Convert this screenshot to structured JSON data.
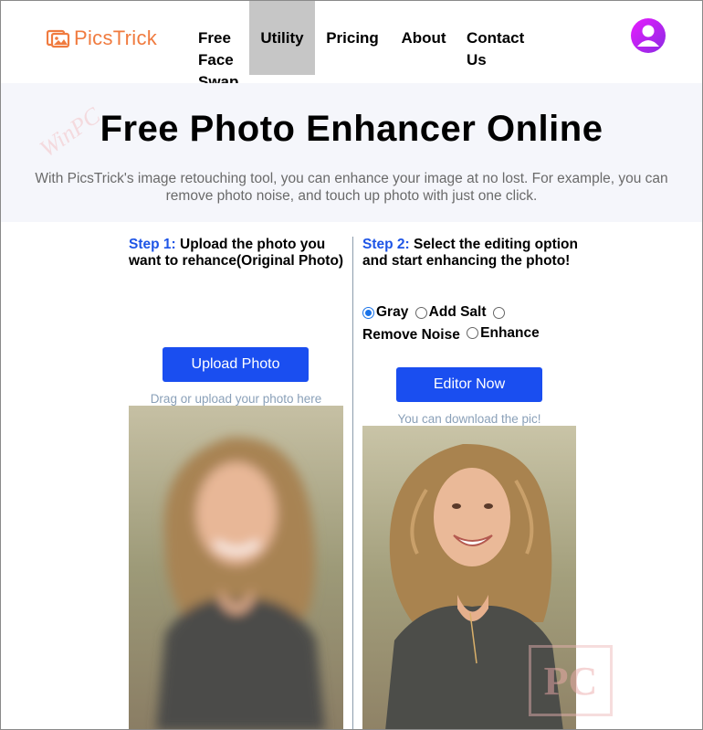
{
  "header": {
    "logo_text": "PicsTrick",
    "nav": [
      {
        "label": "Free Face Swap"
      },
      {
        "label": "Utility",
        "active": true
      },
      {
        "label": "Pricing"
      },
      {
        "label": "About"
      },
      {
        "label": "Contact Us"
      }
    ],
    "avatar_icon": "user-avatar-icon",
    "brand_color": "#f07b3f",
    "avatar_color": "#cc22ee"
  },
  "hero": {
    "title": "Free Photo Enhancer Online",
    "subtitle": "With PicsTrick's image retouching tool, you can enhance your image at no lost. For example, you can remove photo noise, and touch up photo with just one click."
  },
  "step1": {
    "num": "Step 1:",
    "text": " Upload the photo you want to rehance(Original Photo)",
    "button": "Upload Photo",
    "hint": "Drag or upload your photo here"
  },
  "step2": {
    "num": "Step 2:",
    "text": " Select the editing option and start enhancing the photo!",
    "options": [
      {
        "label": "Gray",
        "checked": true
      },
      {
        "label": "Add Salt",
        "checked": false
      },
      {
        "label": "Remove Noise",
        "checked": false
      },
      {
        "label": "Enhance",
        "checked": false
      }
    ],
    "button": "Editor Now",
    "hint": "You can download the pic!"
  },
  "colors": {
    "accent": "#1a4ef0",
    "step_label": "#1e55e6",
    "hint": "#8aa0b8"
  }
}
